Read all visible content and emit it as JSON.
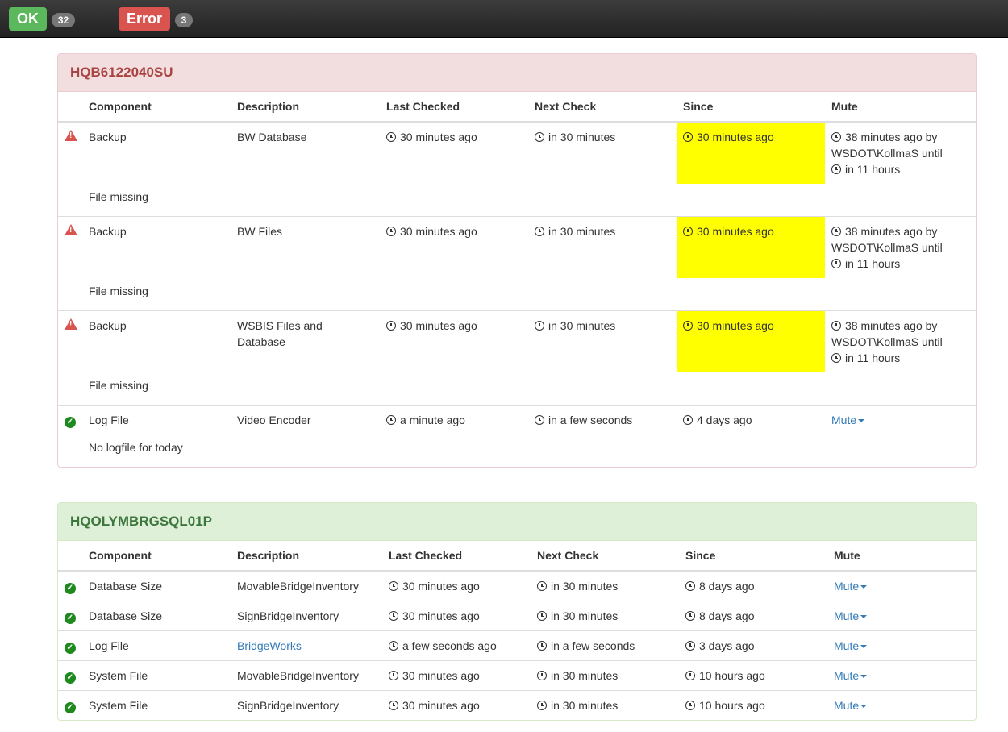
{
  "topbar": {
    "ok_label": "OK",
    "ok_count": "32",
    "error_label": "Error",
    "error_count": "3"
  },
  "columns": [
    "Component",
    "Description",
    "Last Checked",
    "Next Check",
    "Since",
    "Mute"
  ],
  "panel1": {
    "title": "HQB6122040SU",
    "rows": [
      {
        "component": "Backup",
        "description": "BW Database",
        "last": "30 minutes ago",
        "next": "in 30 minutes",
        "since": "30 minutes ago",
        "mute_line1": "38 minutes ago by",
        "mute_line2": "WSDOT\\KollmaS until",
        "mute_line3": "in 11 hours",
        "message": "File missing"
      },
      {
        "component": "Backup",
        "description": "BW Files",
        "last": "30 minutes ago",
        "next": "in 30 minutes",
        "since": "30 minutes ago",
        "mute_line1": "38 minutes ago by",
        "mute_line2": "WSDOT\\KollmaS until",
        "mute_line3": "in 11 hours",
        "message": "File missing"
      },
      {
        "component": "Backup",
        "description": "WSBIS Files and Database",
        "last": "30 minutes ago",
        "next": "in 30 minutes",
        "since": "30 minutes ago",
        "mute_line1": "38 minutes ago by",
        "mute_line2": "WSDOT\\KollmaS until",
        "mute_line3": "in 11 hours",
        "message": "File missing"
      },
      {
        "component": "Log File",
        "description": "Video Encoder",
        "last": "a minute ago",
        "next": "in a few seconds",
        "since": "4 days ago",
        "mute": "Mute",
        "message": "No logfile for today"
      }
    ]
  },
  "panel2": {
    "title": "HQOLYMBRGSQL01P",
    "rows": [
      {
        "component": "Database Size",
        "description": "MovableBridgeInventory",
        "last": "30 minutes ago",
        "next": "in 30 minutes",
        "since": "8 days ago",
        "mute": "Mute"
      },
      {
        "component": "Database Size",
        "description": "SignBridgeInventory",
        "last": "30 minutes ago",
        "next": "in 30 minutes",
        "since": "8 days ago",
        "mute": "Mute"
      },
      {
        "component": "Log File",
        "description": "BridgeWorks",
        "last": "a few seconds ago",
        "next": "in a few seconds",
        "since": "3 days ago",
        "mute": "Mute"
      },
      {
        "component": "System File",
        "description": "MovableBridgeInventory",
        "last": "30 minutes ago",
        "next": "in 30 minutes",
        "since": "10 hours ago",
        "mute": "Mute"
      },
      {
        "component": "System File",
        "description": "SignBridgeInventory",
        "last": "30 minutes ago",
        "next": "in 30 minutes",
        "since": "10 hours ago",
        "mute": "Mute"
      }
    ]
  },
  "colors": {
    "ok": "#5cb85c",
    "error": "#d9534f",
    "highlight": "#ffff00",
    "link": "#337ab7"
  },
  "icons": {
    "error": "warning-triangle-icon",
    "ok": "check-circle-icon",
    "time": "clock-icon",
    "dropdown": "caret-down-icon"
  }
}
